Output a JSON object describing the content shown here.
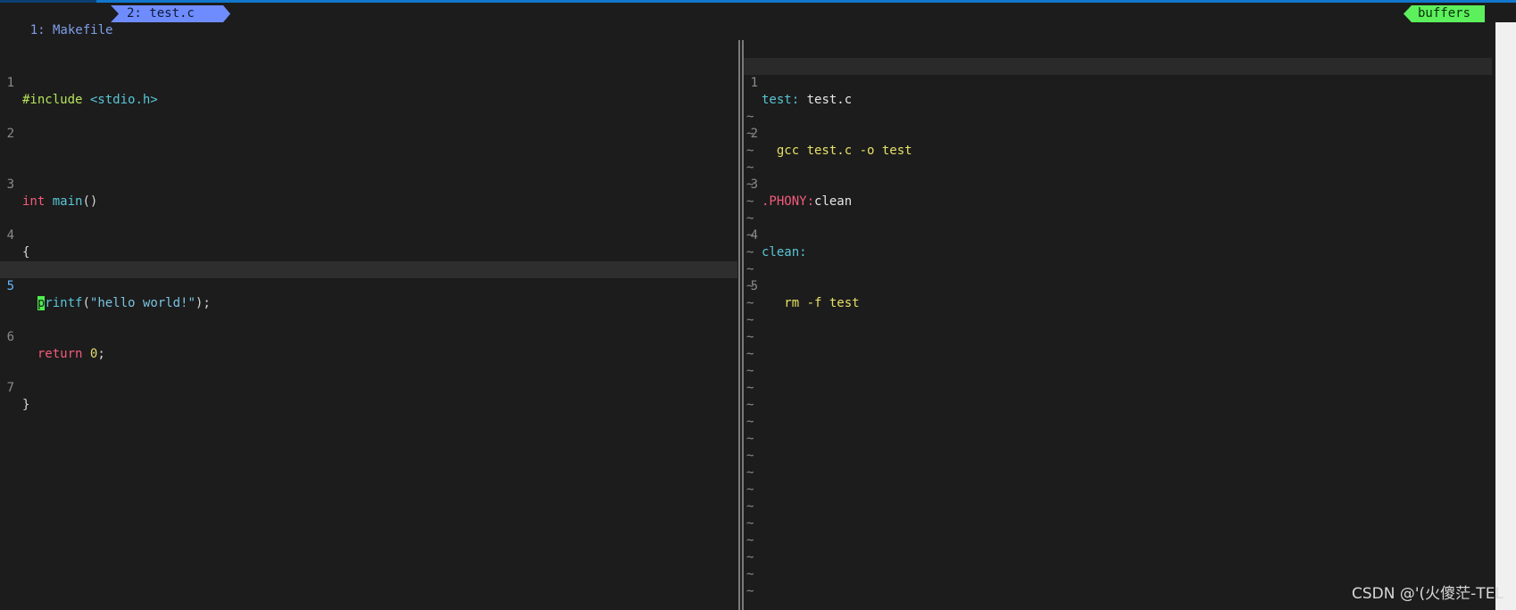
{
  "tabline": {
    "tab1": "1: Makefile",
    "tab2": "2: test.c",
    "buffers_label": "buffers"
  },
  "left_buffer": {
    "lines": [
      {
        "n": "1",
        "text": "#include <stdio.h>"
      },
      {
        "n": "2",
        "text": ""
      },
      {
        "n": "3",
        "text": "int main()"
      },
      {
        "n": "4",
        "text": "{"
      },
      {
        "n": "5",
        "text": "  printf(\"hello world!\");"
      },
      {
        "n": "6",
        "text": "  return 0;"
      },
      {
        "n": "7",
        "text": "}"
      }
    ],
    "cursor_line": "5",
    "cursor_char": "p"
  },
  "right_buffer": {
    "lines": [
      {
        "n": "1",
        "text": "test: test.c"
      },
      {
        "n": "2",
        "text": "  gcc test.c -o test"
      },
      {
        "n": "3",
        "text": ".PHONY:clean"
      },
      {
        "n": "4",
        "text": "clean:"
      },
      {
        "n": "5",
        "text": "   rm -f test"
      }
    ],
    "empty_line_marker": "~"
  },
  "watermark": "CSDN @'(火傻茫-TEL",
  "colors": {
    "background": "#1c1c1c",
    "tab_active": "#6f8cff",
    "buffers_badge": "#5cf05c",
    "cursor": "#4cf04c",
    "keyword": "#f45b7a",
    "function": "#58c6d6",
    "string": "#79c3e0",
    "number": "#e6db74"
  }
}
